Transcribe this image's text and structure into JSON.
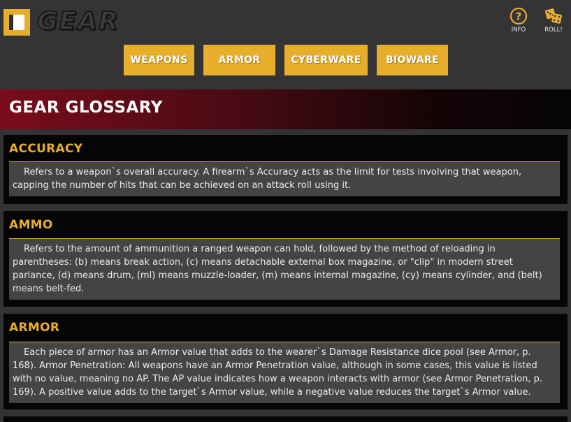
{
  "app": {
    "logo_text": "GEAR"
  },
  "tools": {
    "info_label": "INFO",
    "roll_label": "ROLL!"
  },
  "nav": {
    "weapons": "WEAPONS",
    "armor": "ARMOR",
    "cyberware": "CYBERWARE",
    "bioware": "BIOWARE"
  },
  "page": {
    "title": "GEAR GLOSSARY"
  },
  "entries": [
    {
      "term": "ACCURACY",
      "definition": "Refers to a weapon`s overall accuracy. A firearm`s Accuracy acts as the limit for tests involving that weapon, capping the number of hits that can be achieved on an attack roll using it."
    },
    {
      "term": "AMMO",
      "definition": "Refers to the amount of ammunition a ranged weapon can hold, followed by the method of reloading in parentheses: (b) means break action, (c) means detachable external box magazine, or \"clip\" in modern street parlance, (d) means drum, (ml) means muzzle-loader, (m) means internal magazine, (cy) means cylinder, and (belt) means belt-fed."
    },
    {
      "term": "ARMOR",
      "definition": "Each piece of armor has an Armor value that adds to the wearer`s Damage Resistance dice pool (see Armor, p. 168). Armor Penetration: All weapons have an Armor Penetration value, although in some cases, this value is listed with no value, meaning no AP. The AP value indicates how a weapon interacts with armor (see Armor Penetration, p. 169). A positive value adds to the target`s Armor value, while a negative value reduces the target`s Armor value."
    }
  ],
  "colors": {
    "accent": "#e7ae2b",
    "banner": "#7a0c1c",
    "card": "#050505",
    "card_body": "#444446"
  },
  "icons": {
    "menu": "menu-icon",
    "info": "question-circle-icon",
    "roll": "dice-icon"
  }
}
